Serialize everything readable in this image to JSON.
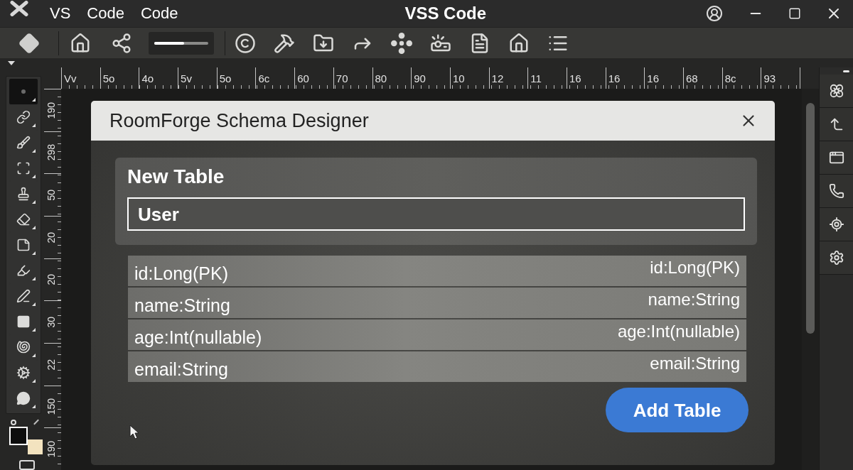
{
  "title_bar": {
    "menu": [
      "VS",
      "Code",
      "Code"
    ],
    "title": "VSS Code"
  },
  "toolbar": {
    "slider": {
      "level": 0.55
    }
  },
  "rulers": {
    "horizontal": [
      "Vv",
      "5o",
      "4o",
      "5v",
      "5o",
      "6c",
      "60",
      "70",
      "80",
      "90",
      "10",
      "12",
      "11",
      "16",
      "16",
      "16",
      "68",
      "8c",
      "93"
    ],
    "vertical": [
      "190",
      "298",
      "50",
      "20",
      "20",
      "30",
      "22",
      "150",
      "190"
    ]
  },
  "tool_panel": {
    "tools": [
      {
        "selected": true
      },
      {
        "selected": false
      },
      {
        "selected": false
      },
      {
        "selected": false
      },
      {
        "selected": false
      },
      {
        "selected": false
      },
      {
        "selected": false
      },
      {
        "selected": false
      },
      {
        "selected": false
      },
      {
        "selected": false
      },
      {
        "selected": false
      },
      {
        "selected": false
      },
      {
        "selected": false
      }
    ],
    "swatches": [
      {
        "color": "#0d0d0d"
      },
      {
        "color": "#f3e3bf"
      }
    ]
  },
  "dialog": {
    "title": "RoomForge Schema Designer",
    "section_title": "New Table",
    "table_name": {
      "value": "User"
    },
    "fields": [
      {
        "left_text": "id:Long(PK)",
        "right_text": "id:Long(PK)"
      },
      {
        "left_text": "name:String",
        "right_text": "name:String"
      },
      {
        "left_text": "age:Int(nullable)",
        "right_text": "age:Int(nullable)"
      },
      {
        "left_text": "email:String",
        "right_text": "email:String"
      }
    ],
    "button": "Add Table"
  }
}
